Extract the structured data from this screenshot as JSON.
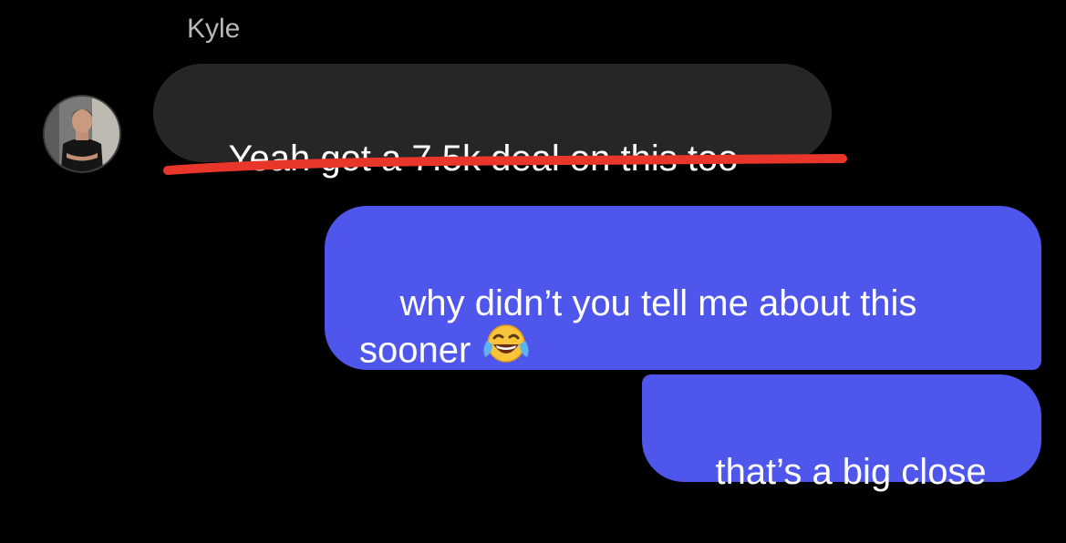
{
  "conversation": {
    "sender_name": "Kyle",
    "messages": [
      {
        "direction": "incoming",
        "text": "Yeah got a 7.5k deal on this too",
        "annotation": "red underline"
      },
      {
        "direction": "outgoing",
        "text": "why didn’t you tell me about this sooner",
        "emoji": "face-with-tears-of-joy"
      },
      {
        "direction": "outgoing",
        "text": "that’s a big close"
      }
    ]
  },
  "colors": {
    "background": "#000000",
    "incoming_bubble": "#262626",
    "outgoing_bubble": "#4f56ec",
    "underline": "#e8372a",
    "sender_name": "#b9b9bd"
  }
}
